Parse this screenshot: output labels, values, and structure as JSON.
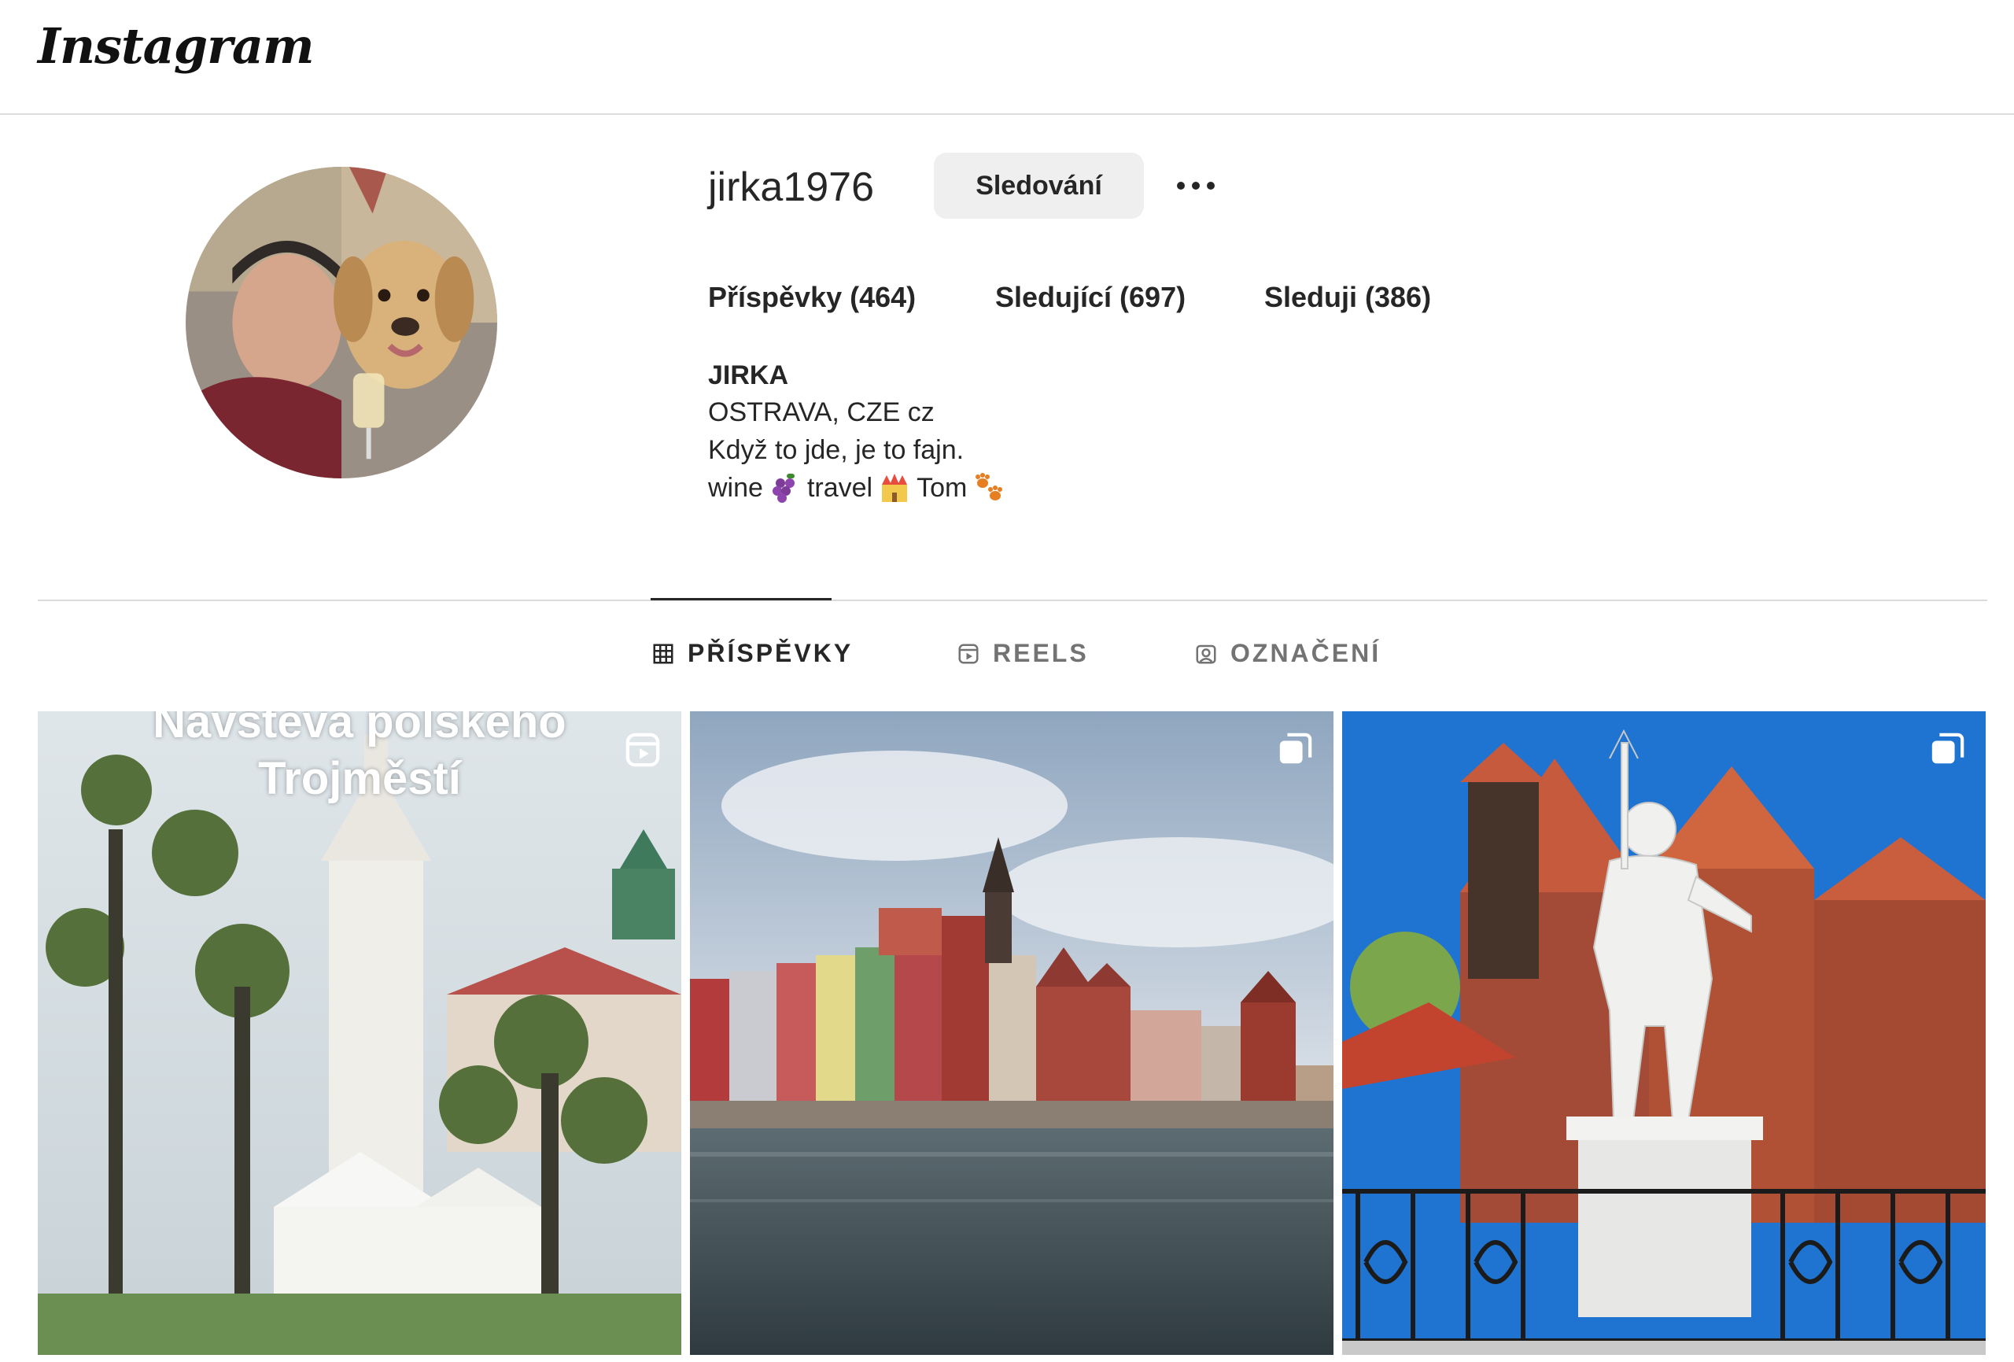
{
  "app": {
    "logo_text": "Instagram"
  },
  "profile": {
    "username": "jirka1976",
    "follow_button_label": "Sledování",
    "more_options_label": "...",
    "stats": {
      "posts": "Příspěvky (464)",
      "followers": "Sledující (697)",
      "following": "Sleduji (386)"
    },
    "bio": {
      "name": "JIRKA",
      "location": "OSTRAVA, CZE cz",
      "quote": "Když to jde, je to fajn.",
      "tag_wine": "wine",
      "tag_travel": "travel",
      "tag_tom": "Tom"
    }
  },
  "tabs": [
    {
      "label": "PŘÍSPĚVKY",
      "icon": "grid-icon",
      "active": true
    },
    {
      "label": "REELS",
      "icon": "reels-icon",
      "active": false
    },
    {
      "label": "OZNAČENÍ",
      "icon": "tagged-icon",
      "active": false
    }
  ],
  "posts": [
    {
      "type": "reel",
      "badge_icon": "reels-icon",
      "overlay_line1": "Návštěva polského",
      "overlay_line2": "Trojměstí"
    },
    {
      "type": "carousel",
      "badge_icon": "carousel-icon"
    },
    {
      "type": "carousel",
      "badge_icon": "carousel-icon"
    }
  ],
  "colors": {
    "border": "#dbdbdb",
    "button_bg": "#efefef",
    "text": "#262626",
    "muted": "#737373"
  }
}
